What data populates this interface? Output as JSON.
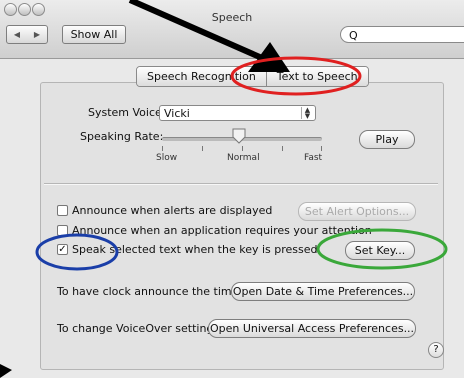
{
  "window": {
    "title": "Speech",
    "nav_back": "◀",
    "nav_forward": "▶",
    "show_all_label": "Show All",
    "search_placeholder": "Q"
  },
  "tabs": [
    {
      "label": "Speech Recognition",
      "selected": false
    },
    {
      "label": "Text to Speech",
      "selected": true
    }
  ],
  "voice": {
    "label": "System Voice:",
    "value": "Vicki"
  },
  "rate": {
    "label": "Speaking Rate:",
    "slow": "Slow",
    "normal": "Normal",
    "fast": "Fast",
    "level_fraction": 0.45
  },
  "play_label": "Play",
  "options": {
    "alerts": {
      "label": "Announce when alerts are displayed",
      "checked": false
    },
    "alert_button": "Set Alert Options...",
    "app_attention": {
      "label": "Announce when an application requires your attention",
      "checked": false
    },
    "speak_selected": {
      "label": "Speak selected text when the key is pressed",
      "checked": true
    },
    "set_key_button": "Set Key..."
  },
  "clock": {
    "label": "To have clock announce the time:",
    "button": "Open Date & Time Preferences..."
  },
  "voiceover": {
    "label": "To change VoiceOver settings:",
    "button": "Open Universal Access Preferences..."
  },
  "help_label": "?",
  "annotation_colors": {
    "red": "#e02020",
    "green": "#3aa83a",
    "blue": "#1a3ea8",
    "arrow": "#000000"
  }
}
